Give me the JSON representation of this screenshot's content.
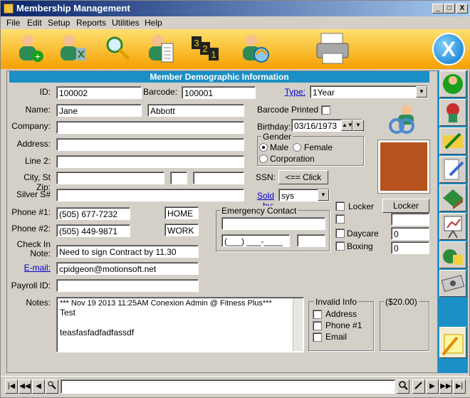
{
  "window": {
    "title": "Membership Management",
    "min": "_",
    "max": "□",
    "close": "X"
  },
  "menu": [
    {
      "label": "File"
    },
    {
      "label": "Edit"
    },
    {
      "label": "Setup"
    },
    {
      "label": "Reports"
    },
    {
      "label": "Utilities"
    },
    {
      "label": "Help"
    }
  ],
  "toolbar": {
    "icons": [
      "add-member-icon",
      "delete-member-icon",
      "search-icon",
      "member-list-icon",
      "numbering-icon",
      "refresh-member-icon",
      "printer-icon"
    ],
    "close_label": "X"
  },
  "section_title": "Member Demographic Information",
  "form": {
    "id_label": "ID:",
    "id": "100002",
    "barcode_label": "Barcode:",
    "barcode": "100001",
    "type_label": "Type:",
    "type": "1Year",
    "name_label": "Name:",
    "first_name": "Jane",
    "last_name": "Abbott",
    "barcode_printed_label": "Barcode Printed",
    "company_label": "Company:",
    "company": "",
    "birthday_label": "Birthday:",
    "birthday": "03/16/1973",
    "address_label": "Address:",
    "address": "",
    "line2_label": "Line 2:",
    "line2": "",
    "sex_group": "Gender",
    "male": "Male",
    "female": "Female",
    "corporation": "Corporation",
    "city_label": "City, St Zip:",
    "city": "",
    "state": "",
    "zip": "",
    "ssn_label": "SSN:",
    "ssn_click": "<== Click",
    "silver_label": "Silver S#",
    "silver": "",
    "sold_by_label": "Sold by:",
    "sold_by": "sys",
    "phone1_label": "Phone #1:",
    "phone1": "(505) 677-7232",
    "phone1_type": "HOME",
    "phone2_label": "Phone #2:",
    "phone2": "(505) 449-9871",
    "phone2_type": "WORK",
    "emergency_label": "Emergency Contact",
    "emergency_name": "",
    "emergency_phone": "(___) ___-____",
    "emergency_ext": "",
    "checkin_label1": "Check In",
    "checkin_label2": "Note:",
    "checkin_note": "Need to sign Contract by 11.30",
    "email_label": "E-mail:",
    "email": "cpidgeon@motionsoft.net",
    "payroll_label": "Payroll ID:",
    "payroll": "",
    "notes_label": "Notes:",
    "notes_line1": "*** Nov 19 2013 11:25AM Conexion Admin @ Fitness Plus***",
    "notes_line2": "Test",
    "notes_line3": "teasfasfadfadfassdf",
    "locker_label": "Locker",
    "locker_button": "Locker",
    "locker_value": "",
    "extra_value": "",
    "daycare_label": "Daycare",
    "daycare_value": "0",
    "boxing_label": "Boxing",
    "boxing_value": "0",
    "invalid_group": "Invalid Info",
    "invalid_address": "Address",
    "invalid_phone": "Phone #1",
    "invalid_email": "Email",
    "balance": "($20.00)"
  },
  "sidebar": {
    "tabs": [
      "member-info-icon",
      "award-icon",
      "pencil-card-icon",
      "edit-document-icon",
      "book-icon",
      "presentation-icon",
      "money-bag-icon",
      "cash-icon"
    ]
  },
  "navbar": {
    "first": "|◀",
    "prev_page": "◀◀",
    "prev": "◀",
    "find": "⌕",
    "next": "▶",
    "next_page": "▶▶",
    "last": "▶|",
    "search_value": ""
  }
}
